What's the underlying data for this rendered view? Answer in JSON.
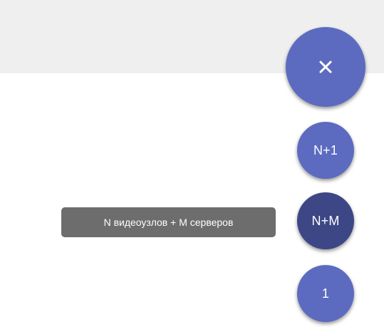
{
  "speed_dial": {
    "close_icon": "close-icon",
    "actions": [
      {
        "label": "N+1"
      },
      {
        "label": "N+M"
      },
      {
        "label": "1"
      }
    ],
    "tooltip": "N видеоузлов + M серверов"
  },
  "colors": {
    "fab": "#5c6bc0",
    "fab_active": "#3d4785",
    "tooltip_bg": "#6d6d6d",
    "top_band": "#efefef",
    "background": "#ffffff"
  }
}
